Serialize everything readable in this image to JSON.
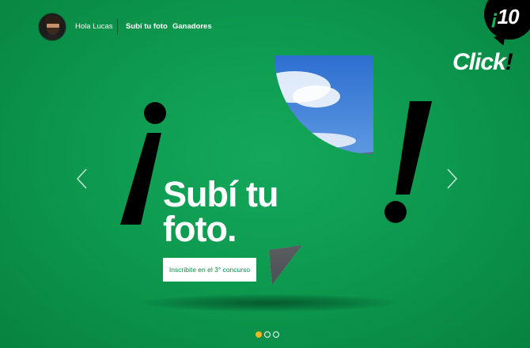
{
  "header": {
    "greeting": "Hola Lucas",
    "nav": [
      {
        "label": "Subí tu foto",
        "active": true
      },
      {
        "label": "Ganadores",
        "active": false
      }
    ]
  },
  "logo": {
    "number_prefix": "¡",
    "number": "10",
    "word": "Click",
    "word_suffix": "!"
  },
  "slide": {
    "headline_line1": "Subí tu",
    "headline_line2": "foto.",
    "cta_label": "Inscribite en el 3° concurso"
  },
  "carousel": {
    "slide_count": 3,
    "active_index": 0
  },
  "colors": {
    "background": "#0d9a4f",
    "accent_dot": "#f2b81d",
    "button_text": "#0d8a45",
    "exclamation": "#000000"
  },
  "icons": {
    "prev": "chevron-left-icon",
    "next": "chevron-right-icon"
  }
}
